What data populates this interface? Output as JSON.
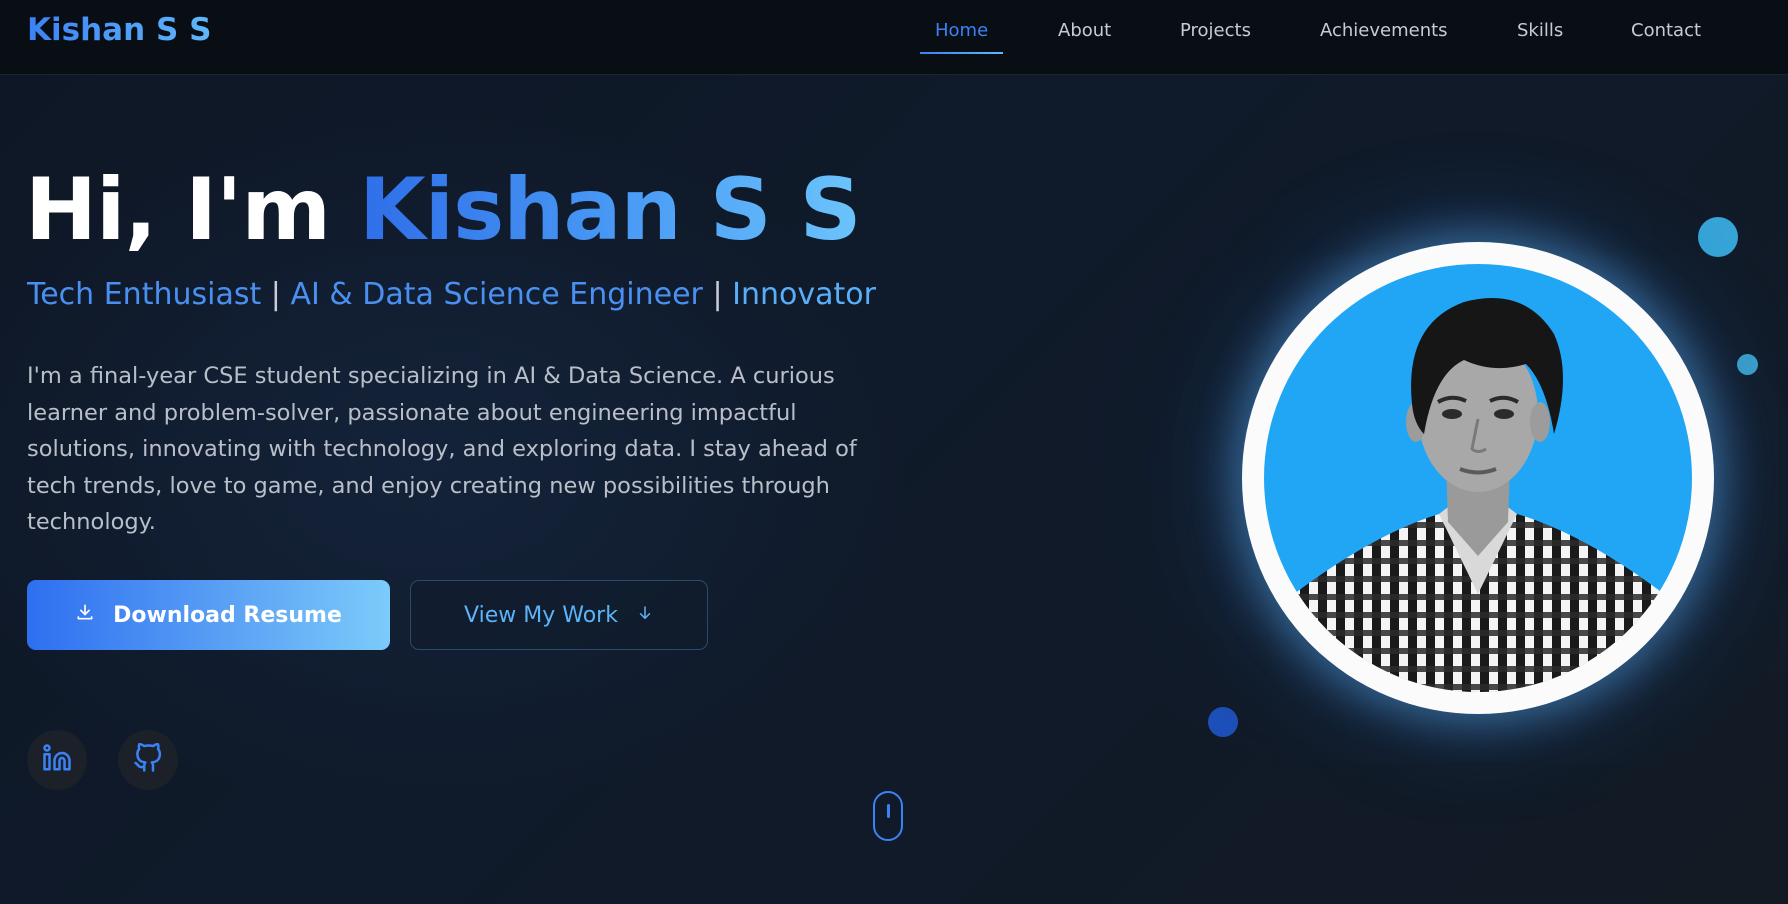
{
  "nav": {
    "logo": "Kishan S S",
    "links": [
      "Home",
      "About",
      "Projects",
      "Achievements",
      "Skills",
      "Contact"
    ],
    "active": "Home"
  },
  "hero": {
    "greeting": "Hi, I'm",
    "name": "Kishan S S",
    "tagline": {
      "parts": [
        "Tech Enthusiast",
        "AI & Data Science Engineer",
        "Innovator"
      ],
      "separator": "|"
    },
    "bio": "I'm a final-year CSE student specializing in AI & Data Science. A curious learner and problem-solver, passionate about engineering impactful solutions, innovating with technology, and exploring data. I stay ahead of tech trends, love to game, and enjoy creating new possibilities through technology.",
    "buttons": {
      "primary": {
        "label": "Download Resume",
        "icon": "download-icon"
      },
      "secondary": {
        "label": "View My Work",
        "icon": "arrow-down-icon"
      }
    },
    "social": [
      {
        "name": "linkedin",
        "icon": "linkedin-icon"
      },
      {
        "name": "github",
        "icon": "github-icon"
      }
    ]
  },
  "colors": {
    "accent": "#3b82f6",
    "accent_light": "#60b8fa",
    "background": "#0d1420",
    "nav_background": "#090d14",
    "photo_background": "#21a6f6"
  }
}
